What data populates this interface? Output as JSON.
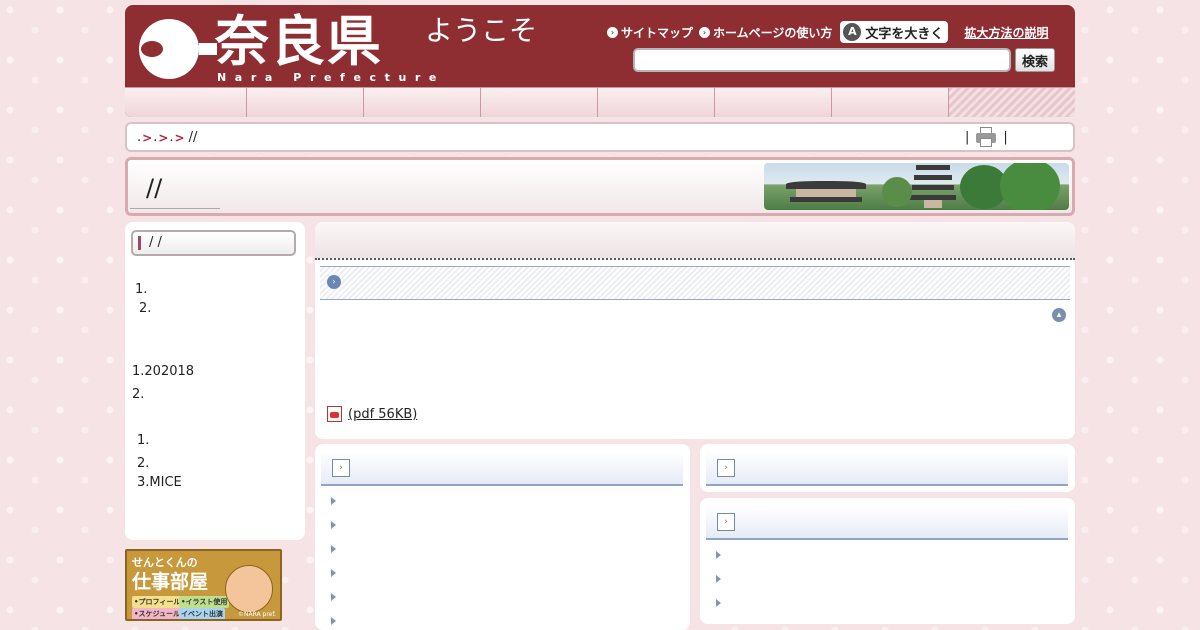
{
  "header": {
    "logo_title": "奈良県",
    "logo_sub": "Nara Prefecture",
    "welcome": "ようこそ",
    "sitemap": "サイトマップ",
    "howto": "ホームページの使い方",
    "enlarge": "文字を大きく",
    "enlarge_icon": "A",
    "help": "拡大方法の説明",
    "search_placeholder": "",
    "search_button": "検索"
  },
  "breadcrumb": {
    "text": "//",
    "separator_pipe_left": "|",
    "separator_pipe_right": "|"
  },
  "page": {
    "title": "//"
  },
  "sidebar": {
    "heading": "/ /",
    "list1": [
      "1.",
      "2."
    ],
    "list2": [
      "1.202018",
      "2."
    ],
    "list3": [
      "1.",
      "2.",
      "3.MICE"
    ]
  },
  "banner_sento": {
    "line1": "せんとくんの",
    "line2": "仕事部屋",
    "tags": [
      "•プロフィール",
      "•イラスト使用",
      "•スケジュール",
      "イベント出演"
    ],
    "copyright": "©NARA pref."
  },
  "main": {
    "pdf_link": "(pdf 56KB)"
  },
  "colors": {
    "header_bg": "#8e2e33",
    "accent": "#b0263e",
    "link_blue": "#6a87b5"
  },
  "icons": [
    "printer-icon",
    "pdf-icon",
    "back-to-top-icon",
    "section-bullet-icon",
    "arrow-right-icon"
  ]
}
